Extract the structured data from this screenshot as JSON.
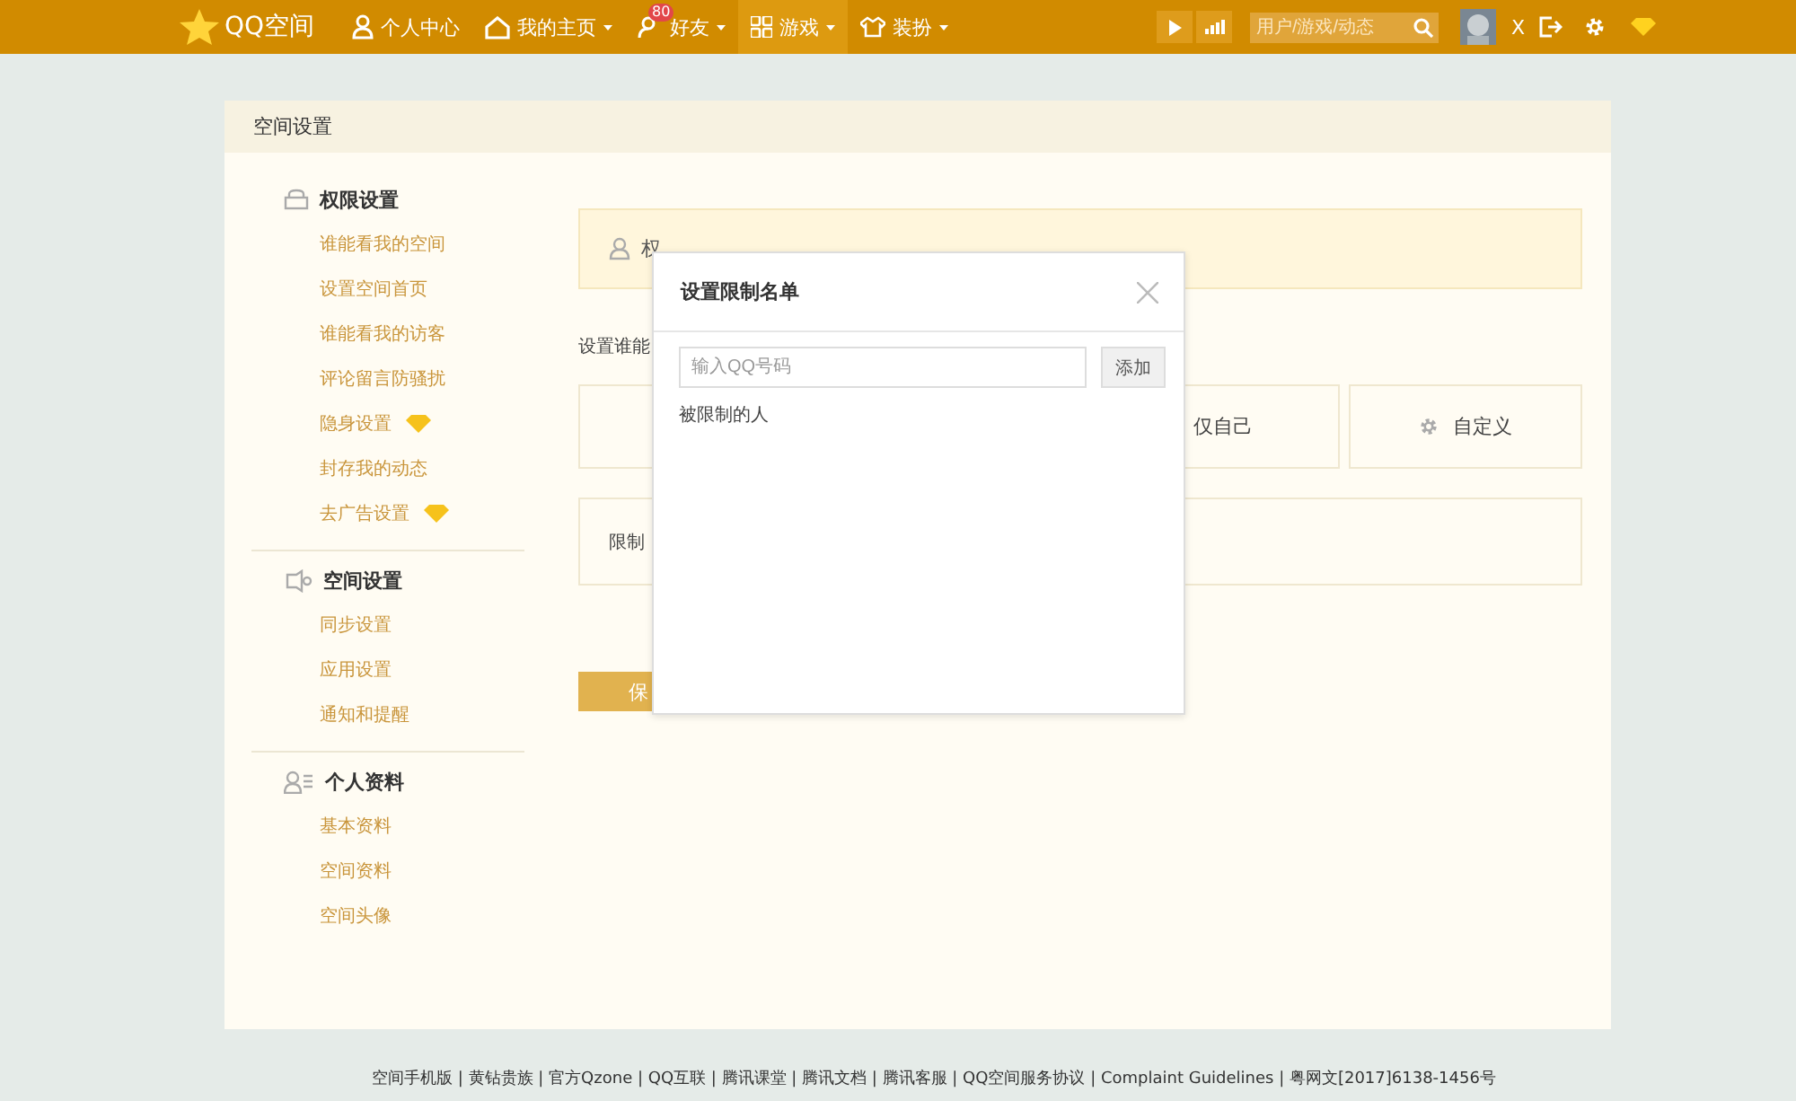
{
  "topbar": {
    "logo": "QQ空间",
    "nav": [
      {
        "label": "个人中心",
        "dropdown": false,
        "selected": false
      },
      {
        "label": "我的主页",
        "dropdown": true,
        "selected": false
      },
      {
        "label": "好友",
        "dropdown": true,
        "selected": false,
        "badge": "80"
      },
      {
        "label": "游戏",
        "dropdown": true,
        "selected": true
      },
      {
        "label": "装扮",
        "dropdown": true,
        "selected": false
      }
    ],
    "search": {
      "placeholder": "用户/游戏/动态"
    },
    "user": "X"
  },
  "panel": {
    "title": "空间设置",
    "sidebar": [
      {
        "title": "权限设置",
        "items": [
          {
            "label": "谁能看我的空间",
            "vip": false
          },
          {
            "label": "设置空间首页",
            "vip": false
          },
          {
            "label": "谁能看我的访客",
            "vip": false
          },
          {
            "label": "评论留言防骚扰",
            "vip": false
          },
          {
            "label": "隐身设置",
            "vip": true
          },
          {
            "label": "封存我的动态",
            "vip": false
          },
          {
            "label": "去广告设置",
            "vip": true
          }
        ]
      },
      {
        "title": "空间设置",
        "items": [
          {
            "label": "同步设置",
            "vip": false
          },
          {
            "label": "应用设置",
            "vip": false
          },
          {
            "label": "通知和提醒",
            "vip": false
          }
        ]
      },
      {
        "title": "个人资料",
        "items": [
          {
            "label": "基本资料",
            "vip": false
          },
          {
            "label": "空间资料",
            "vip": false
          },
          {
            "label": "空间头像",
            "vip": false
          }
        ]
      }
    ],
    "notice": "权",
    "access_label": "设置谁能",
    "options": [
      {
        "kind": "hidden"
      },
      {
        "kind": "text",
        "label": "仅自己"
      },
      {
        "kind": "custom",
        "label": "自定义"
      }
    ],
    "limit_label": "限制",
    "save_button": "保"
  },
  "dialog": {
    "title": "设置限制名单",
    "input": {
      "placeholder": "输入QQ号码"
    },
    "add_button": "添加",
    "list_label": "被限制的人"
  },
  "footer": "空间手机版 | 黄钻贵族 | 官方Qzone | QQ互联 | 腾讯课堂 | 腾讯文档 | 腾讯客服 | QQ空间服务协议 | Complaint Guidelines | 粤网文[2017]6138-1456号"
}
